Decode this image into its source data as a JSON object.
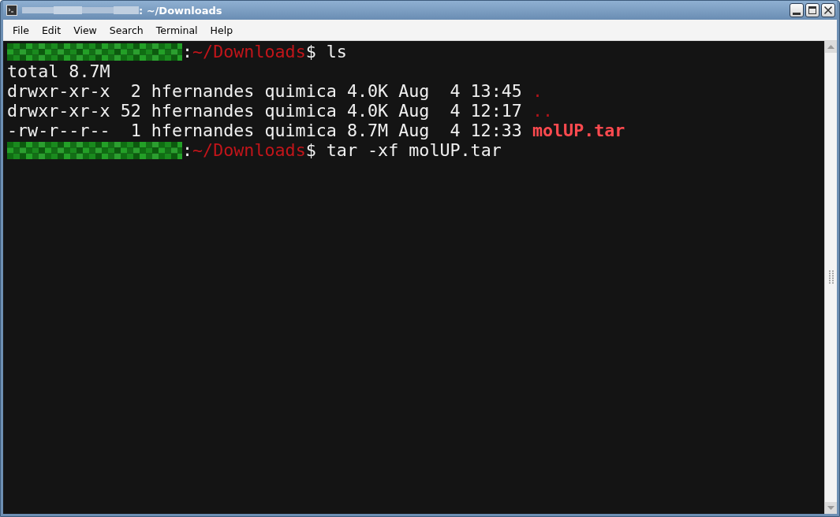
{
  "window": {
    "title": ": ~/Downloads"
  },
  "menu": [
    "File",
    "Edit",
    "View",
    "Search",
    "Terminal",
    "Help"
  ],
  "terminal": {
    "lines": [
      {
        "segments": [
          {
            "kind": "redacted"
          },
          {
            "kind": "plain",
            "text": ":"
          },
          {
            "kind": "path",
            "text": "~/Downloads"
          },
          {
            "kind": "plain",
            "text": "$ ls"
          }
        ]
      },
      {
        "segments": [
          {
            "kind": "plain",
            "text": "total 8.7M"
          }
        ]
      },
      {
        "segments": [
          {
            "kind": "plain",
            "text": "drwxr-xr-x  2 hfernandes quimica 4.0K Aug  4 13:45 "
          },
          {
            "kind": "dir",
            "text": "."
          }
        ]
      },
      {
        "segments": [
          {
            "kind": "plain",
            "text": "drwxr-xr-x 52 hfernandes quimica 4.0K Aug  4 12:17 "
          },
          {
            "kind": "dir",
            "text": ".."
          }
        ]
      },
      {
        "segments": [
          {
            "kind": "plain",
            "text": "-rw-r--r--  1 hfernandes quimica 8.7M Aug  4 12:33 "
          },
          {
            "kind": "archive",
            "text": "molUP.tar"
          }
        ]
      },
      {
        "segments": [
          {
            "kind": "redacted"
          },
          {
            "kind": "plain",
            "text": ":"
          },
          {
            "kind": "path",
            "text": "~/Downloads"
          },
          {
            "kind": "plain",
            "text": "$ tar -xf molUP.tar"
          }
        ]
      }
    ]
  }
}
